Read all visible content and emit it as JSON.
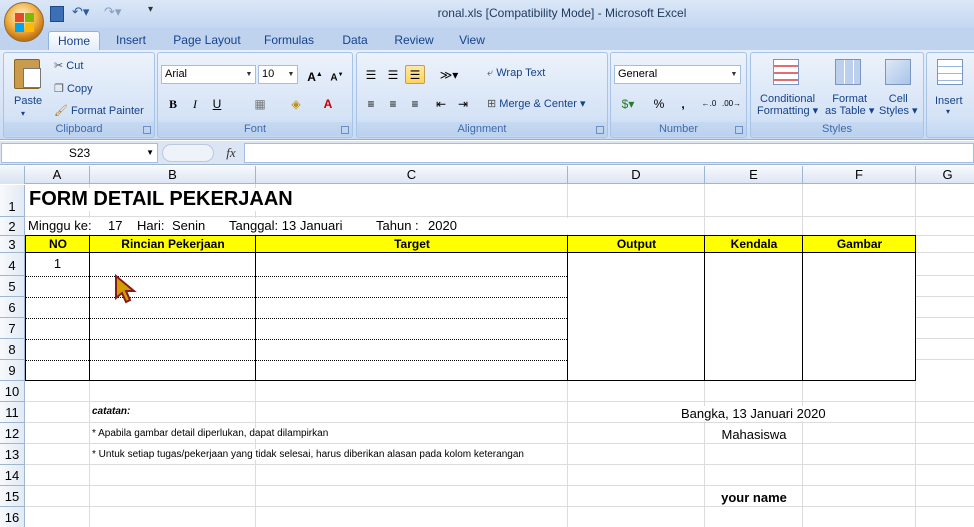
{
  "window": {
    "title": "ronal.xls  [Compatibility Mode]  -  Microsoft Excel"
  },
  "tabs": [
    "Home",
    "Insert",
    "Page Layout",
    "Formulas",
    "Data",
    "Review",
    "View"
  ],
  "ribbon": {
    "clipboard": {
      "label": "Clipboard",
      "paste": "Paste",
      "cut": "Cut",
      "copy": "Copy",
      "format_painter": "Format Painter"
    },
    "font": {
      "label": "Font",
      "family": "Arial",
      "size": "10"
    },
    "alignment": {
      "label": "Alignment",
      "wrap": "Wrap Text",
      "merge": "Merge & Center"
    },
    "number": {
      "label": "Number",
      "format": "General"
    },
    "styles": {
      "label": "Styles",
      "cond1": "Conditional",
      "cond2": "Formatting",
      "table1": "Format",
      "table2": "as Table",
      "cell1": "Cell",
      "cell2": "Styles"
    },
    "cells": {
      "insert": "Insert"
    }
  },
  "formula_bar": {
    "namebox": "S23",
    "fx": "fx",
    "value": ""
  },
  "columns": [
    "A",
    "B",
    "C",
    "D",
    "E",
    "F",
    "G"
  ],
  "rows": [
    "1",
    "2",
    "3",
    "4",
    "5",
    "6",
    "7",
    "8",
    "9",
    "10",
    "11",
    "12",
    "13",
    "14",
    "15",
    "16"
  ],
  "sheet": {
    "title": "FORM DETAIL PEKERJAAN",
    "row2": {
      "minggu_label": "Minggu ke:",
      "minggu_val": "17",
      "hari_label": "Hari:",
      "hari_val": "Senin",
      "tanggal": "Tanggal: 13 Januari",
      "tahun_label": "Tahun :",
      "tahun_val": "2020"
    },
    "headers": [
      "NO",
      "Rincian Pekerjaan",
      "Target",
      "Output",
      "Kendala",
      "Gambar"
    ],
    "no_first": "1",
    "catatan": "catatan:",
    "note1": "* Apabila gambar detail diperlukan, dapat dilampirkan",
    "note2": "* Untuk setiap tugas/pekerjaan yang tidak selesai, harus diberikan alasan pada kolom keterangan",
    "place_date": "Bangka, 13 Januari 2020",
    "role": "Mahasiswa",
    "signer": "your name"
  }
}
